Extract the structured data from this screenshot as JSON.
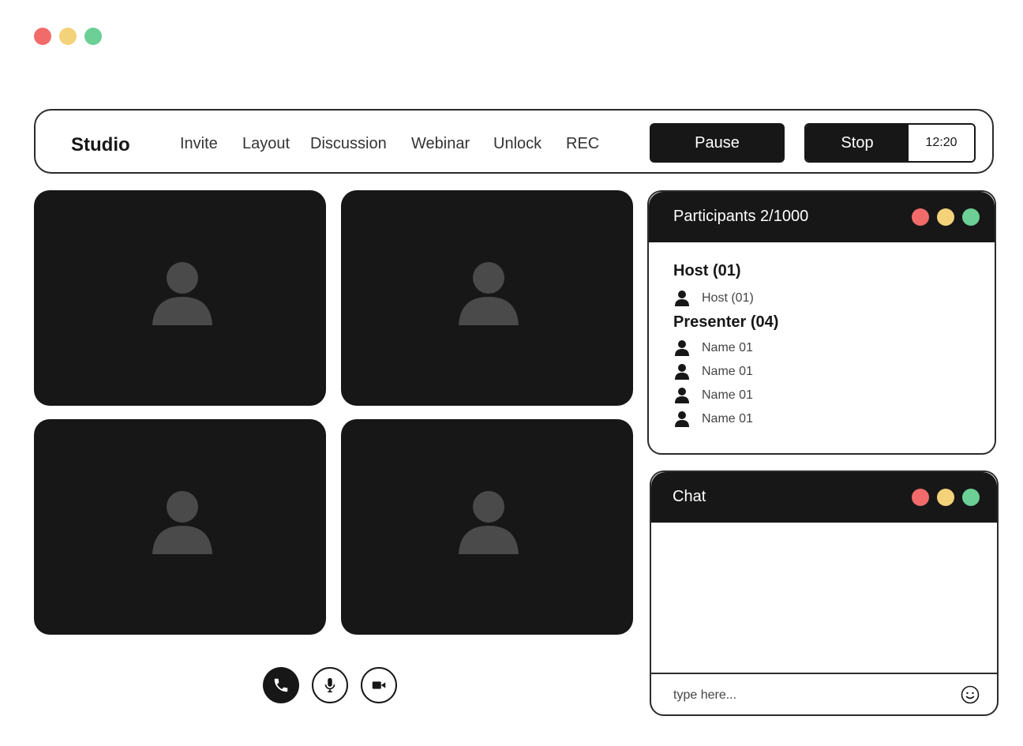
{
  "window": {
    "controls": [
      "close",
      "minimize",
      "maximize"
    ],
    "colors": {
      "close": "#f26b6b",
      "minimize": "#f3d27a",
      "maximize": "#6ccf95"
    }
  },
  "topbar": {
    "brand": "Studio",
    "nav": [
      "Invite",
      "Layout",
      "Discussion",
      "Webinar",
      "Unlock",
      "REC"
    ],
    "pause_label": "Pause",
    "stop_label": "Stop",
    "timer": "12:20"
  },
  "video_tiles": [
    {
      "icon": "user-avatar-icon"
    },
    {
      "icon": "user-avatar-icon"
    },
    {
      "icon": "user-avatar-icon"
    },
    {
      "icon": "user-avatar-icon"
    }
  ],
  "participants": {
    "title": "Participants 2/1000",
    "host_title": "Host (01)",
    "hosts": [
      "Host (01)"
    ],
    "presenter_title": "Presenter (04)",
    "presenters": [
      "Name 01",
      "Name 01",
      "Name 01",
      "Name 01"
    ]
  },
  "chat": {
    "title": "Chat",
    "placeholder": "type here...",
    "emoji_icon": "smiley-icon"
  },
  "controls": {
    "call_icon": "phone-icon",
    "mic_icon": "microphone-icon",
    "video_icon": "video-camera-icon"
  },
  "colors": {
    "dark": "#171717",
    "avatar": "#4a4a4a",
    "background": "#ffffff"
  }
}
